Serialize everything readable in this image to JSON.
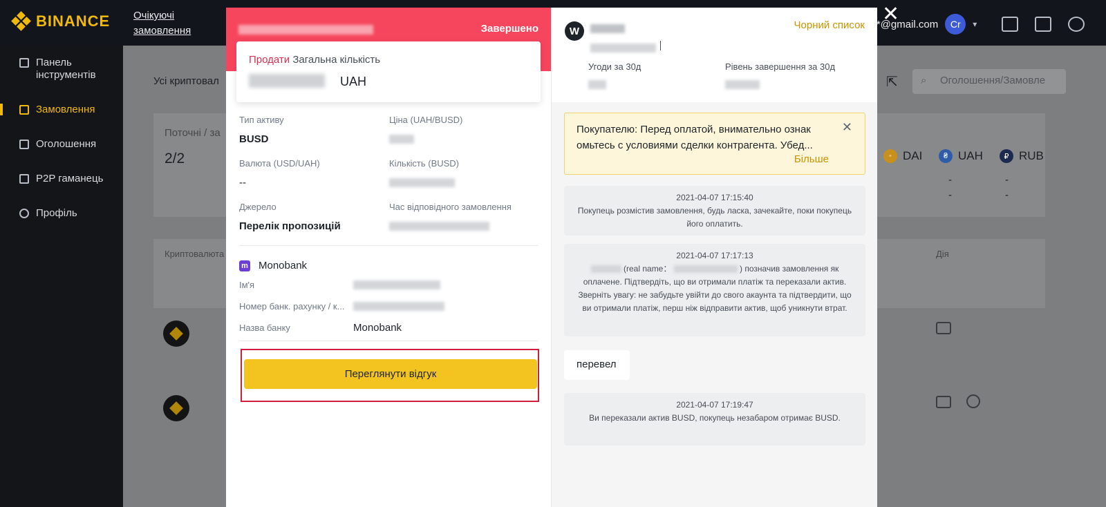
{
  "header": {
    "brand": "BINANCE",
    "nav_pending_line1": "Очікуючі",
    "nav_pending_line2": "замовлення",
    "email_suffix": "**@gmail.com",
    "avatar_letter": "Cr"
  },
  "sidebar": {
    "items": [
      {
        "label": "Панель інструментів"
      },
      {
        "label": "Замовлення"
      },
      {
        "label": "Оголошення"
      },
      {
        "label": "P2P гаманець"
      },
      {
        "label": "Профіль"
      }
    ]
  },
  "background": {
    "filter_label": "Усі криптовал",
    "current_label": "Поточні / за",
    "count": "2/2",
    "crypto_col": "Криптовалюта",
    "action_col": "Дія",
    "search_placeholder": "Оголошення/Замовле",
    "coins": [
      "DAI",
      "UAH",
      "RUB"
    ],
    "dash": "-"
  },
  "order": {
    "status": "Завершено",
    "sell_word": "Продати",
    "total_label": "Загальна кількість",
    "currency": "UAH",
    "asset_type_label": "Тип активу",
    "asset_type_value": "BUSD",
    "price_label": "Ціна (UAH/BUSD)",
    "rate_label": "Валюта (USD/UAH)",
    "rate_value": "--",
    "quantity_label": "Кількість (BUSD)",
    "source_label": "Джерело",
    "source_value": "Перелік пропозицій",
    "order_time_label": "Час відповідного замовлення",
    "payment_method": "Monobank",
    "name_label": "Ім'я",
    "account_label": "Номер банк. рахунку / к...",
    "bank_name_label": "Назва банку",
    "bank_name_value": "Monobank",
    "review_button": "Переглянути відгук"
  },
  "chat": {
    "counterparty_initial": "W",
    "blacklist": "Чорний список",
    "trades_label": "Угоди за 30д",
    "completion_label": "Рівень завершення за 30д",
    "notice_text": "Покупателю: Перед оплатой, внимательно ознак омьтесь с условиями сделки контрагента. Убед...",
    "notice_more": "Більше",
    "messages": [
      {
        "time": "2021-04-07 17:15:40",
        "text": "Покупець розмістив замовлення, будь ласка, зачекайте, поки покупець його оплатить."
      },
      {
        "time": "2021-04-07 17:17:13",
        "text_a": "(real name：",
        "text_b": ") позначив замовлення як оплачене. Підтвердіть, що ви отримали платіж та переказали актив. Зверніть увагу: не забудьте увійти до свого акаунта та підтвердити, що ви отримали платіж, перш ніж відправити актив, щоб уникнути втрат."
      },
      {
        "time": "2021-04-07 17:19:47",
        "text": "Ви переказали актив BUSD, покупець незабаром отримає BUSD."
      }
    ],
    "user_message": "перевел"
  }
}
